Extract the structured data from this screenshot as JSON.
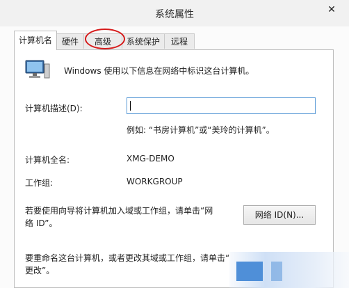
{
  "window": {
    "title": "系统属性",
    "close_glyph": "✕"
  },
  "tabs": [
    {
      "label": "计算机名",
      "active": true
    },
    {
      "label": "硬件"
    },
    {
      "label": "高级"
    },
    {
      "label": "系统保护"
    },
    {
      "label": "远程"
    }
  ],
  "intro_text": "Windows 使用以下信息在网络中标识这台计算机。",
  "description": {
    "label": "计算机描述(D):",
    "value": "",
    "example": "例如: “书房计算机”或“美玲的计算机”。"
  },
  "full_name": {
    "label": "计算机全名:",
    "value": "XMG-DEMO"
  },
  "workgroup": {
    "label": "工作组:",
    "value": "WORKGROUP"
  },
  "network_id": {
    "text_line1": "若要使用向导将计算机加入域或工作组，请单击“网",
    "text_line2": "络 ID”。",
    "button_label": "网络 ID(N)..."
  },
  "rename": {
    "text_line1": "要重命名这台计算机，或者更改其域或工作组，请单击“",
    "text_line2": "更改”。"
  },
  "colors": {
    "highlight_circle": "#d61b1b",
    "input_border": "#5a9ad6"
  }
}
